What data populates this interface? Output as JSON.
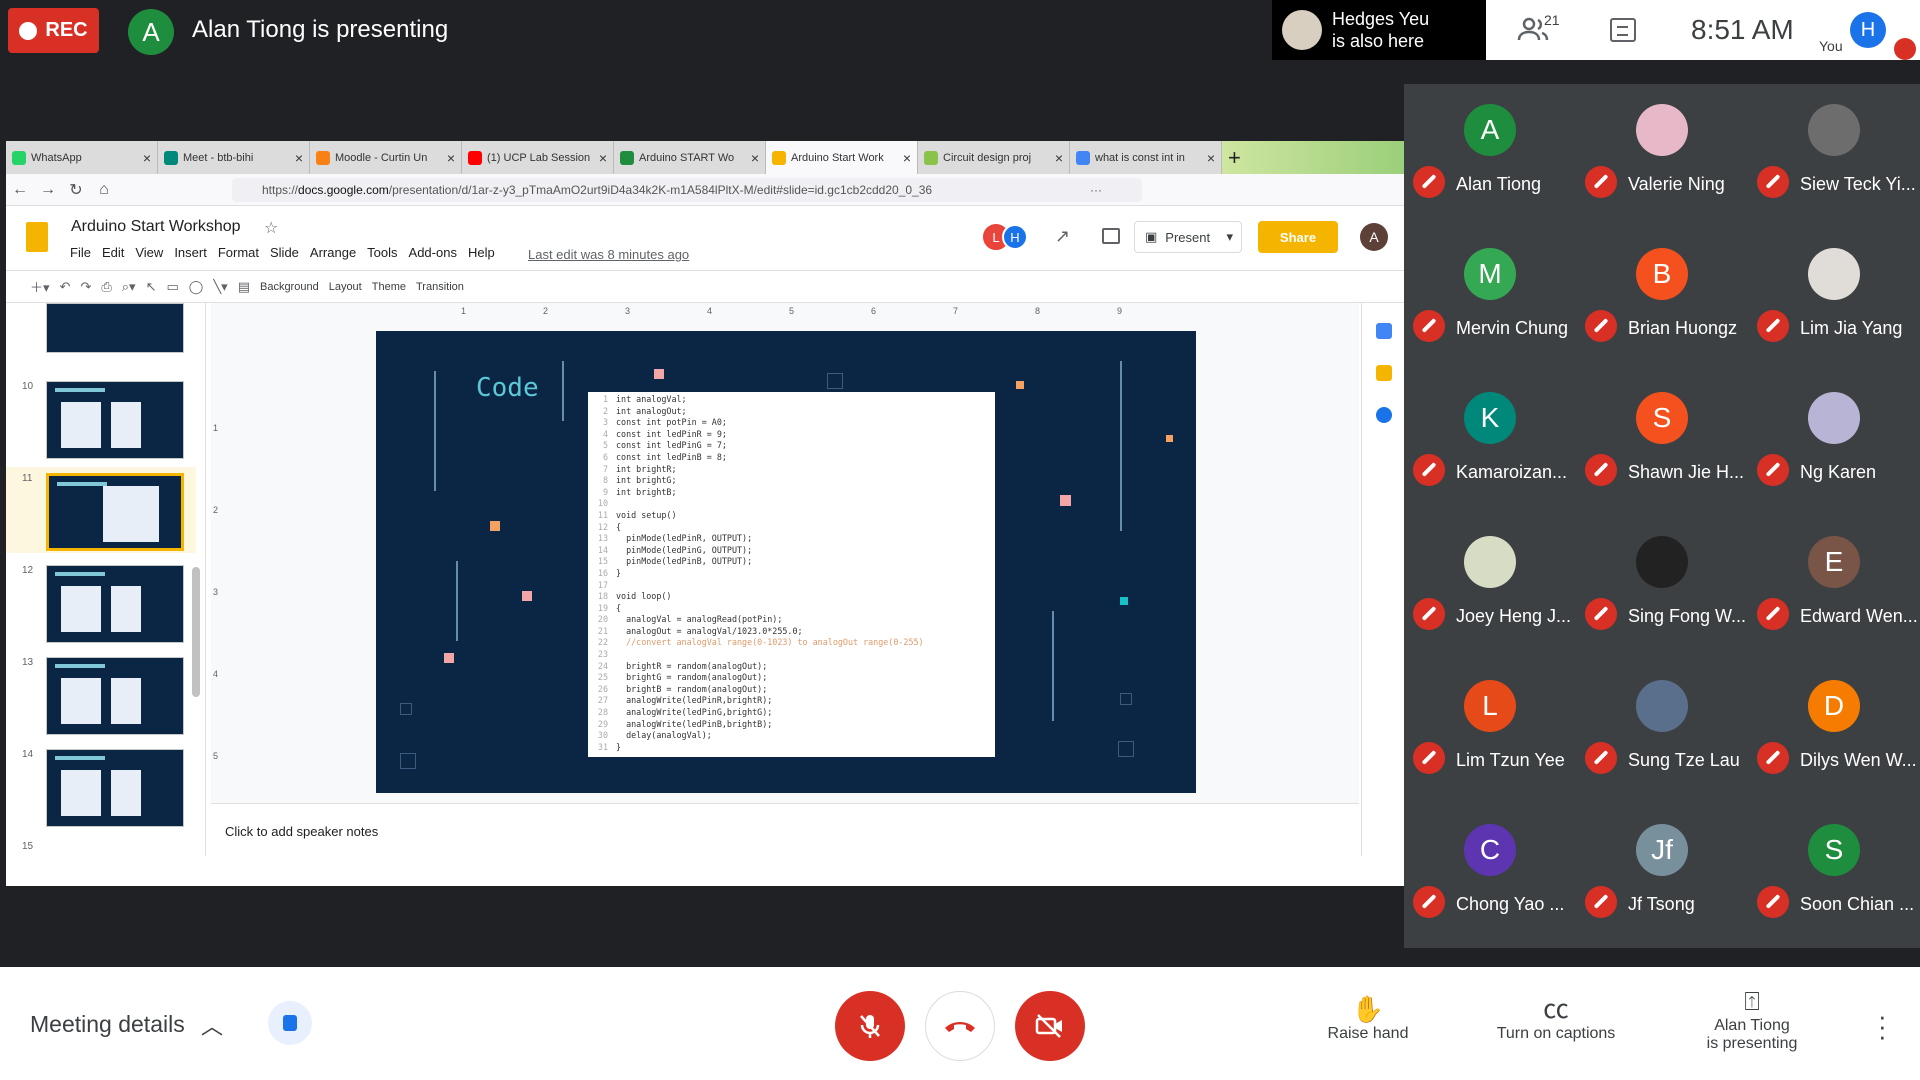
{
  "top": {
    "rec_label": "REC",
    "presenter_initial": "A",
    "presenting_text": "Alan Tiong is presenting",
    "also_here_name": "Hedges Yeu",
    "also_here_text": "is also here",
    "participant_count": "21",
    "clock": "8:51  AM",
    "you_label": "You",
    "you_initial": "H"
  },
  "browser": {
    "tabs": [
      {
        "label": "WhatsApp",
        "color": "#25d366"
      },
      {
        "label": "Meet - btb-bihi",
        "color": "#00897b"
      },
      {
        "label": "Moodle - Curtin Un",
        "color": "#f98012"
      },
      {
        "label": "(1) UCP Lab Session",
        "color": "#ff0000"
      },
      {
        "label": "Arduino START Wo",
        "color": "#1e8e3e"
      },
      {
        "label": "Arduino Start Work",
        "color": "#f4b400"
      },
      {
        "label": "Circuit design proj",
        "color": "#8bc34a"
      },
      {
        "label": "what is const int in",
        "color": "#4285f4"
      }
    ],
    "url_prefix": "https://",
    "url_domain": "docs.google.com",
    "url_path": "/presentation/d/1ar-z-y3_pTmaAmO2urt9iD4a34k2K-m1A584lPltX-M/edit#slide=id.gc1cb2cdd20_0_36",
    "url_more": "···"
  },
  "slides_app": {
    "title": "Arduino Start Workshop",
    "menus": [
      "File",
      "Edit",
      "View",
      "Insert",
      "Format",
      "Slide",
      "Arrange",
      "Tools",
      "Add-ons",
      "Help"
    ],
    "last_edit": "Last edit was 8 minutes ago",
    "collab1": "L",
    "collab2": "H",
    "present_label": "Present",
    "share_label": "Share",
    "account_initial": "A",
    "toolbar": {
      "background": "Background",
      "layout": "Layout",
      "theme": "Theme",
      "transition": "Transition"
    },
    "ruler": [
      "1",
      "2",
      "3",
      "4",
      "5",
      "6",
      "7",
      "8",
      "9"
    ],
    "vruler": [
      "1",
      "2",
      "3",
      "4",
      "5"
    ],
    "thumb_numbers": [
      "10",
      "11",
      "12",
      "13",
      "14",
      "15"
    ],
    "speaker_notes": "Click to add speaker notes",
    "slide_title": "Code",
    "code_lines": [
      {
        "n": "1",
        "t": "int analogVal;"
      },
      {
        "n": "2",
        "t": "int analogOut;"
      },
      {
        "n": "3",
        "t": "const int potPin = A0;"
      },
      {
        "n": "4",
        "t": "const int ledPinR = 9;"
      },
      {
        "n": "5",
        "t": "const int ledPinG = 7;"
      },
      {
        "n": "6",
        "t": "const int ledPinB = 8;"
      },
      {
        "n": "7",
        "t": "int brightR;"
      },
      {
        "n": "8",
        "t": "int brightG;"
      },
      {
        "n": "9",
        "t": "int brightB;"
      },
      {
        "n": "10",
        "t": ""
      },
      {
        "n": "11",
        "t": "void setup()"
      },
      {
        "n": "12",
        "t": "{"
      },
      {
        "n": "13",
        "t": "  pinMode(ledPinR, OUTPUT);"
      },
      {
        "n": "14",
        "t": "  pinMode(ledPinG, OUTPUT);"
      },
      {
        "n": "15",
        "t": "  pinMode(ledPinB, OUTPUT);"
      },
      {
        "n": "16",
        "t": "}"
      },
      {
        "n": "17",
        "t": ""
      },
      {
        "n": "18",
        "t": "void loop()"
      },
      {
        "n": "19",
        "t": "{"
      },
      {
        "n": "20",
        "t": "  analogVal = analogRead(potPin);"
      },
      {
        "n": "21",
        "t": "  analogOut = analogVal/1023.0*255.0;"
      },
      {
        "n": "22",
        "t": "  //convert analogVal range(0-1023) to analogOut range(0-255)"
      },
      {
        "n": "23",
        "t": ""
      },
      {
        "n": "24",
        "t": "  brightR = random(analogOut);"
      },
      {
        "n": "25",
        "t": "  brightG = random(analogOut);"
      },
      {
        "n": "26",
        "t": "  brightB = random(analogOut);"
      },
      {
        "n": "27",
        "t": "  analogWrite(ledPinR,brightR);"
      },
      {
        "n": "28",
        "t": "  analogWrite(ledPinG,brightG);"
      },
      {
        "n": "29",
        "t": "  analogWrite(ledPinB,brightB);"
      },
      {
        "n": "30",
        "t": "  delay(analogVal);"
      },
      {
        "n": "31",
        "t": "}"
      }
    ]
  },
  "participants": [
    {
      "name": "Alan Tiong",
      "initial": "A",
      "color": "#1e8e3e"
    },
    {
      "name": "Valerie Ning",
      "initial": "",
      "color": "#e6b8c8"
    },
    {
      "name": "Siew Teck Yi...",
      "initial": "",
      "color": "#6d6d6d"
    },
    {
      "name": "Mervin Chung",
      "initial": "M",
      "color": "#34a853"
    },
    {
      "name": "Brian Huongz",
      "initial": "B",
      "color": "#f4511e"
    },
    {
      "name": "Lim Jia Yang",
      "initial": "",
      "color": "#e0ddd8"
    },
    {
      "name": "Kamaroizan...",
      "initial": "K",
      "color": "#00897b"
    },
    {
      "name": "Shawn Jie H...",
      "initial": "S",
      "color": "#f4511e"
    },
    {
      "name": "Ng Karen",
      "initial": "",
      "color": "#b8b4d6"
    },
    {
      "name": "Joey Heng J...",
      "initial": "",
      "color": "#d7dcc4"
    },
    {
      "name": "Sing Fong W...",
      "initial": "",
      "color": "#222222"
    },
    {
      "name": "Edward Wen...",
      "initial": "E",
      "color": "#795548"
    },
    {
      "name": "Lim Tzun Yee",
      "initial": "L",
      "color": "#e64a19"
    },
    {
      "name": "Sung Tze Lau",
      "initial": "",
      "color": "#5a6f8c"
    },
    {
      "name": "Dilys Wen W...",
      "initial": "D",
      "color": "#f57c00"
    },
    {
      "name": "Chong Yao ...",
      "initial": "C",
      "color": "#5e35b1"
    },
    {
      "name": "Jf Tsong",
      "initial": "Jf",
      "color": "#78909c"
    },
    {
      "name": "Soon Chian ...",
      "initial": "S",
      "color": "#1e8e3e"
    }
  ],
  "bottom": {
    "meeting_details": "Meeting details",
    "raise_hand": "Raise hand",
    "captions": "Turn on captions",
    "presenting_line1": "Alan Tiong",
    "presenting_line2": "is presenting"
  },
  "colors": {
    "danger": "#d93025",
    "brand_blue": "#1a73e8",
    "slides_yellow": "#f4b400"
  }
}
